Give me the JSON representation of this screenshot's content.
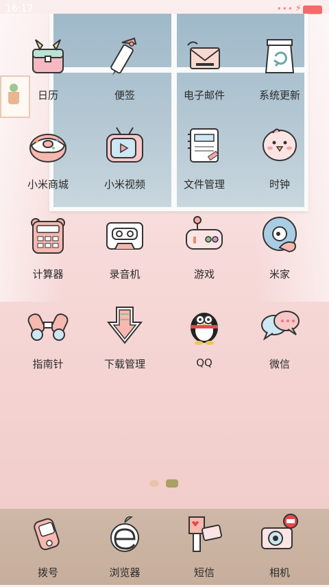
{
  "status": {
    "time": "16:17"
  },
  "apps": [
    {
      "label": "日历",
      "icon": "calendar-bag-icon"
    },
    {
      "label": "便签",
      "icon": "notes-pencil-icon"
    },
    {
      "label": "电子邮件",
      "icon": "email-icon"
    },
    {
      "label": "系统更新",
      "icon": "system-update-icon"
    },
    {
      "label": "小米商城",
      "icon": "donut-store-icon"
    },
    {
      "label": "小米视频",
      "icon": "tv-video-icon"
    },
    {
      "label": "文件管理",
      "icon": "file-manager-icon"
    },
    {
      "label": "时钟",
      "icon": "bird-clock-icon"
    },
    {
      "label": "计算器",
      "icon": "calculator-icon"
    },
    {
      "label": "录音机",
      "icon": "cassette-recorder-icon"
    },
    {
      "label": "游戏",
      "icon": "gamepad-icon"
    },
    {
      "label": "米家",
      "icon": "mijia-icon"
    },
    {
      "label": "指南针",
      "icon": "binoculars-icon"
    },
    {
      "label": "下载管理",
      "icon": "download-arrow-icon"
    },
    {
      "label": "QQ",
      "icon": "penguin-icon"
    },
    {
      "label": "微信",
      "icon": "chat-bubbles-icon"
    }
  ],
  "dock": [
    {
      "label": "拨号",
      "icon": "phone-icon"
    },
    {
      "label": "浏览器",
      "icon": "browser-icon"
    },
    {
      "label": "短信",
      "icon": "mailbox-icon"
    },
    {
      "label": "相机",
      "icon": "camera-icon"
    }
  ]
}
